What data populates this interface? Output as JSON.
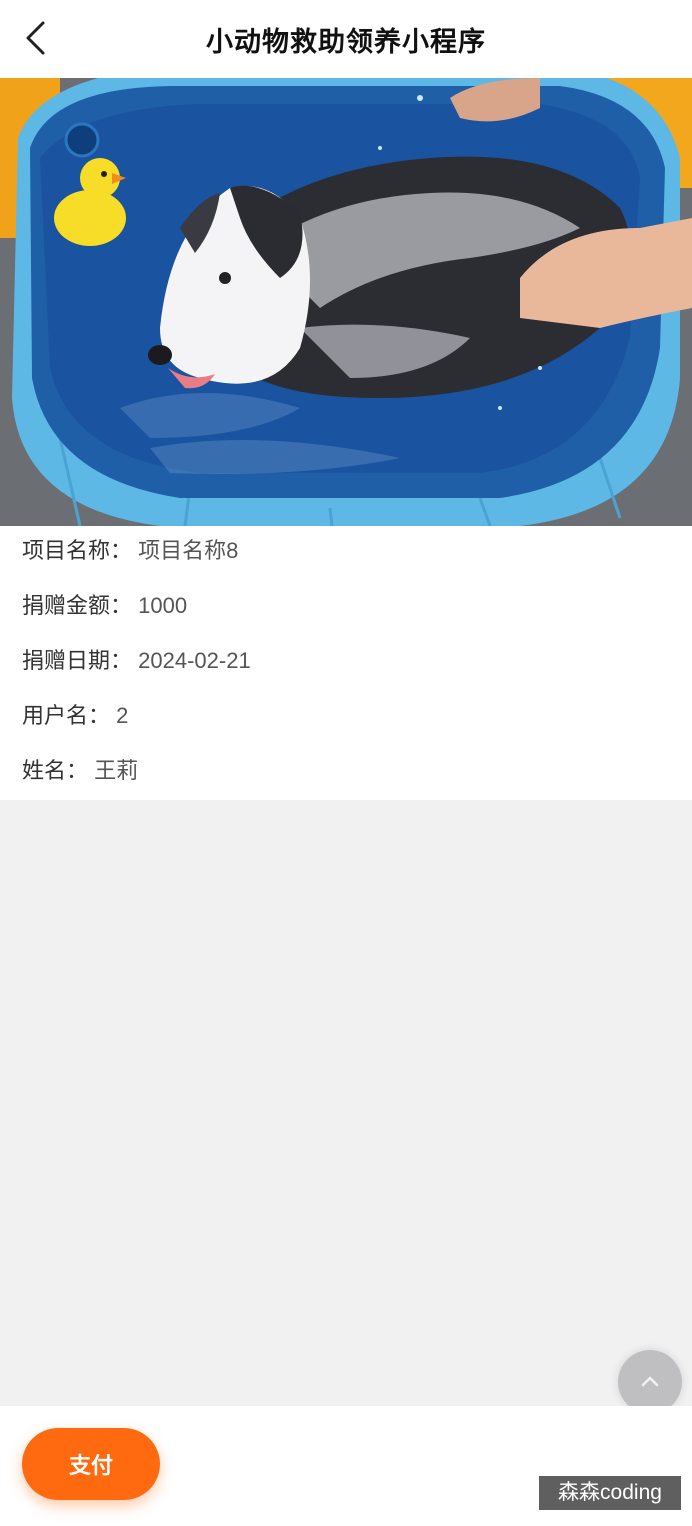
{
  "header": {
    "title": "小动物救助领养小程序",
    "back_icon": "chevron-left-icon"
  },
  "carousel": {
    "image_subject": "dog in blue pool with rubber duck",
    "active_dot_color": "#ff8a00"
  },
  "details": {
    "rows": [
      {
        "label": "项目名称：",
        "value": "项目名称8"
      },
      {
        "label": "捐赠金额：",
        "value": "1000"
      },
      {
        "label": "捐赠日期：",
        "value": "2024-02-21"
      },
      {
        "label": "用户名：",
        "value": "2"
      },
      {
        "label": "姓名：",
        "value": "王莉"
      }
    ]
  },
  "footer": {
    "pay_label": "支付",
    "accent": "#ff6a10"
  },
  "watermark": "森森coding"
}
